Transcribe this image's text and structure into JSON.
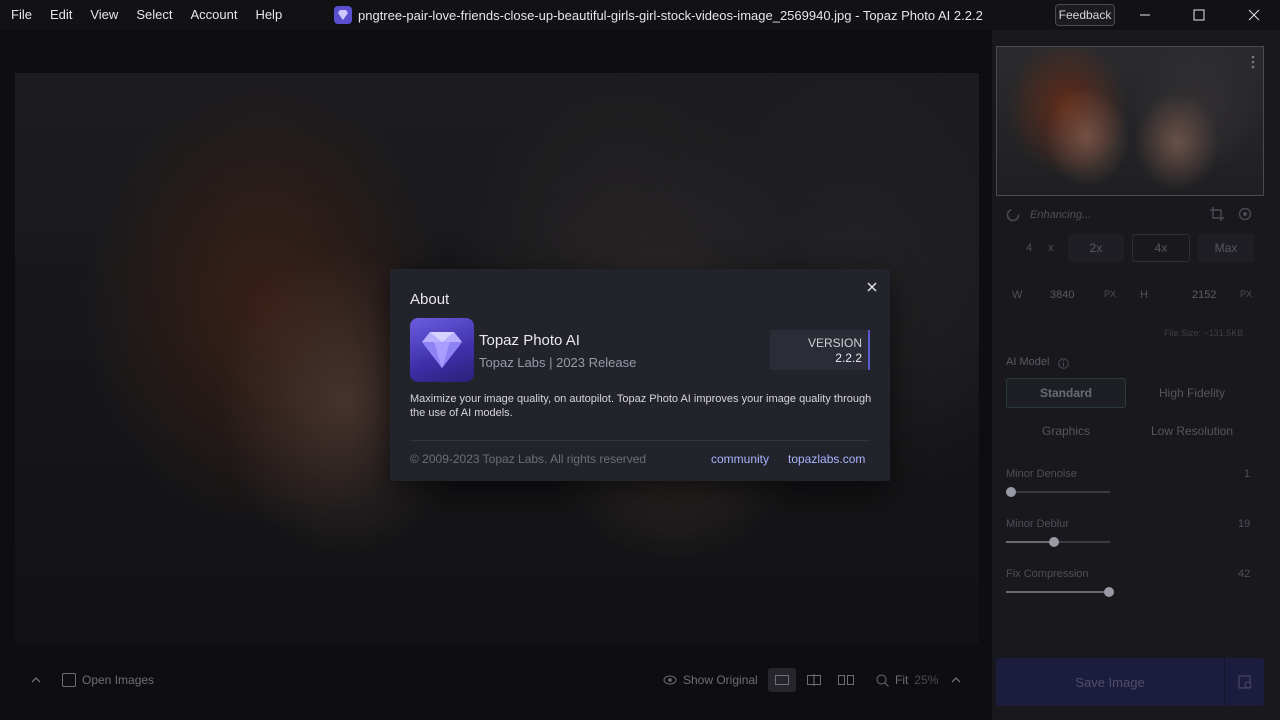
{
  "menu": {
    "file": "File",
    "edit": "Edit",
    "view": "View",
    "select": "Select",
    "account": "Account",
    "help": "Help"
  },
  "window": {
    "title": "pngtree-pair-love-friends-close-up-beautiful-girls-girl-stock-videos-image_2569940.jpg - Topaz Photo AI 2.2.2",
    "feedback": "Feedback"
  },
  "bottombar": {
    "open_images": "Open Images",
    "show_original": "Show Original",
    "fit": "Fit",
    "zoom": "25%"
  },
  "panel": {
    "status": "Enhancing...",
    "scale_options": [
      "4",
      "x",
      "2x",
      "4x",
      "Max"
    ],
    "width_label": "W",
    "width_value": "3840",
    "height_label": "H",
    "height_value": "2152",
    "unit": "PX",
    "file_size": "File Size: ~131.5KB",
    "ai_model_label": "AI Model",
    "models": [
      "Standard",
      "High Fidelity",
      "Graphics",
      "Low Resolution"
    ],
    "sliders": [
      {
        "label": "Minor Denoise",
        "value": "1",
        "level": 0.0
      },
      {
        "label": "Minor Deblur",
        "value": "19",
        "level": 0.19
      },
      {
        "label": "Fix Compression",
        "value": "42",
        "level": 0.42
      }
    ],
    "save_label": "Save Image"
  },
  "about": {
    "title": "About",
    "app_name": "Topaz Photo AI",
    "subtitle": "Topaz Labs | 2023 Release",
    "version_label": "VERSION",
    "version": "2.2.2",
    "description": "Maximize your image quality, on autopilot. Topaz Photo AI improves your image quality through the use of AI models.",
    "copyright": "© 2009-2023 Topaz Labs. All rights reserved",
    "link_community": "community",
    "link_site": "topazlabs.com"
  },
  "colors": {
    "accent": "#5a4fcf",
    "link": "#a8b4ff",
    "dialog_bg": "#22232b"
  }
}
